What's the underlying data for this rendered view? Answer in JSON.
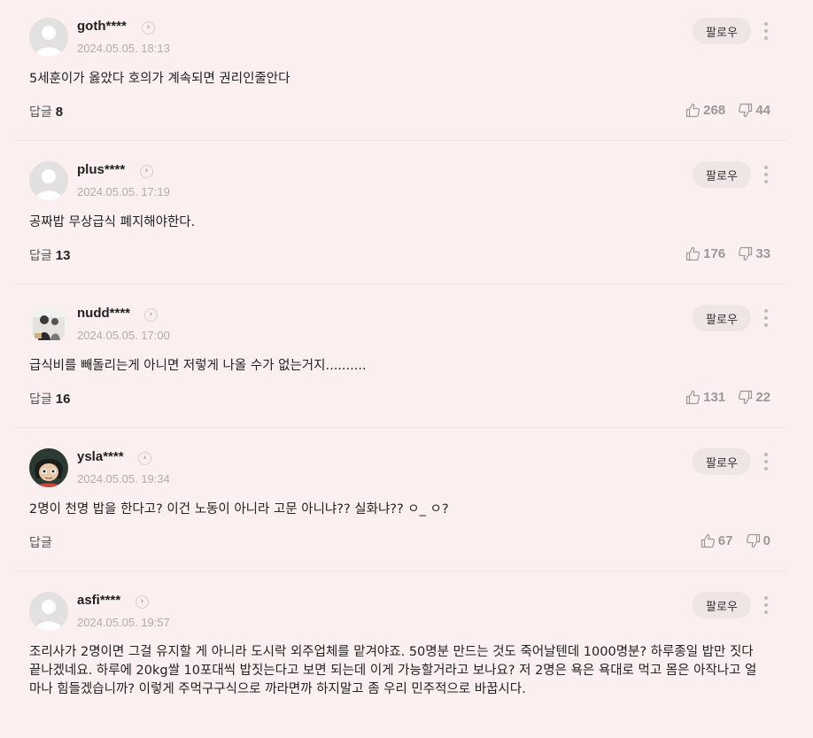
{
  "follow_label": "팔로우",
  "reply_label": "답글",
  "comments": [
    {
      "username": "goth****",
      "date": "2024.05.05. 18:13",
      "text": "5세훈이가 옳았다 호의가 계속되면 권리인줄안다",
      "reply_count": "8",
      "likes": "268",
      "dislikes": "44",
      "avatar": "default-avatar"
    },
    {
      "username": "plus****",
      "date": "2024.05.05. 17:19",
      "text": "공짜밥 무상급식 폐지해야한다.",
      "reply_count": "13",
      "likes": "176",
      "dislikes": "33",
      "avatar": "default-avatar"
    },
    {
      "username": "nudd****",
      "date": "2024.05.05. 17:00",
      "text": "급식비를 빼돌리는게 아니면 저렇게 나올 수가 없는거지..........",
      "reply_count": "16",
      "likes": "131",
      "dislikes": "22",
      "avatar": "photo-avatar"
    },
    {
      "username": "ysla****",
      "date": "2024.05.05. 19:34",
      "text": "2명이 천명 밥을 한다고? 이건 노동이 아니라 고문 아니냐?? 실화냐?? ㅇ_ ㅇ?",
      "reply_count": "",
      "likes": "67",
      "dislikes": "0",
      "avatar": "cartoon-avatar"
    },
    {
      "username": "asfi****",
      "date": "2024.05.05. 19:57",
      "text": "조리사가 2명이면 그걸 유지할 게 아니라 도시락 외주업체를 맡겨야죠. 50명분 만드는 것도 죽어날텐데 1000명분? 하루종일 밥만 짓다 끝나겠네요. 하루에 20kg쌀 10포대씩 밥짓는다고 보면 되는데 이게 가능할거라고 보나요? 저 2명은 욕은 욕대로 먹고 몸은 아작나고 얼마나 힘들겠습니까? 이렇게 주먹구구식으로 까라면까 하지말고 좀 우리 민주적으로 바꿉시다.",
      "reply_count": "",
      "likes": "",
      "dislikes": "",
      "avatar": "default-avatar"
    }
  ]
}
